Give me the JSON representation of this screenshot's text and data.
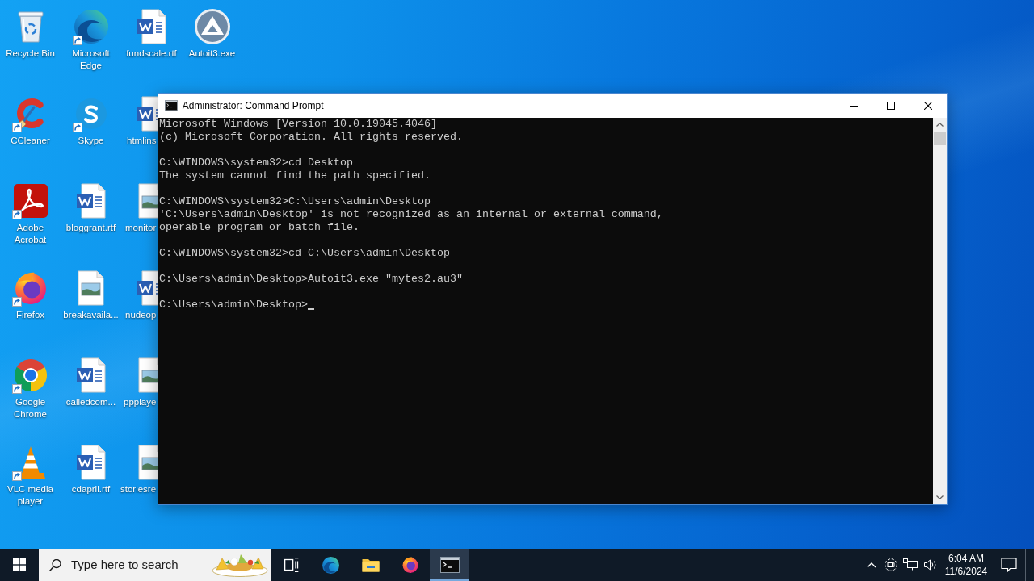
{
  "desktop": {
    "icons": [
      {
        "label": "Recycle Bin",
        "kind": "recycle-bin",
        "shortcut": false
      },
      {
        "label": "CCleaner",
        "kind": "ccleaner",
        "shortcut": true
      },
      {
        "label": "Adobe Acrobat",
        "kind": "acrobat",
        "shortcut": true
      },
      {
        "label": "Firefox",
        "kind": "firefox",
        "shortcut": true
      },
      {
        "label": "Google Chrome",
        "kind": "chrome",
        "shortcut": true
      },
      {
        "label": "VLC media player",
        "kind": "vlc",
        "shortcut": true
      },
      {
        "label": "Microsoft Edge",
        "kind": "edge",
        "shortcut": true
      },
      {
        "label": "Skype",
        "kind": "skype",
        "shortcut": true
      },
      {
        "label": "bloggrant.rtf",
        "kind": "word-doc",
        "shortcut": false
      },
      {
        "label": "breakavaila...",
        "kind": "image-doc",
        "shortcut": false
      },
      {
        "label": "calledcom...",
        "kind": "word-doc",
        "shortcut": false
      },
      {
        "label": "cdapril.rtf",
        "kind": "word-doc",
        "shortcut": false
      },
      {
        "label": "fundscale.rtf",
        "kind": "word-doc",
        "shortcut": false
      },
      {
        "label": "htmlins",
        "kind": "word-doc",
        "shortcut": false
      },
      {
        "label": "monitor",
        "kind": "image-doc",
        "shortcut": false
      },
      {
        "label": "nudeop",
        "kind": "word-doc",
        "shortcut": false
      },
      {
        "label": "ppplaye",
        "kind": "image-doc",
        "shortcut": false
      },
      {
        "label": "storiesre",
        "kind": "image-doc",
        "shortcut": false
      },
      {
        "label": "Autoit3.exe",
        "kind": "autoit",
        "shortcut": false
      }
    ]
  },
  "window": {
    "title": "Administrator: Command Prompt"
  },
  "console": {
    "blocks": [
      [
        "Microsoft Windows [Version 10.0.19045.4046]",
        "(c) Microsoft Corporation. All rights reserved."
      ],
      [
        "C:\\WINDOWS\\system32>cd Desktop",
        "The system cannot find the path specified."
      ],
      [
        "C:\\WINDOWS\\system32>C:\\Users\\admin\\Desktop",
        "'C:\\Users\\admin\\Desktop' is not recognized as an internal or external command,",
        "operable program or batch file."
      ],
      [
        "C:\\WINDOWS\\system32>cd C:\\Users\\admin\\Desktop"
      ],
      [
        "C:\\Users\\admin\\Desktop>Autoit3.exe \"mytes2.au3\""
      ]
    ],
    "prompt": "C:\\Users\\admin\\Desktop>"
  },
  "taskbar": {
    "search": {
      "placeholder": "Type here to search"
    },
    "apps": [
      {
        "kind": "task-view",
        "active": false
      },
      {
        "kind": "edge",
        "active": false
      },
      {
        "kind": "explorer",
        "active": false
      },
      {
        "kind": "firefox",
        "active": false
      },
      {
        "kind": "cmd",
        "active": true
      }
    ],
    "clock": {
      "time": "6:04 AM",
      "date": "11/6/2024"
    }
  }
}
